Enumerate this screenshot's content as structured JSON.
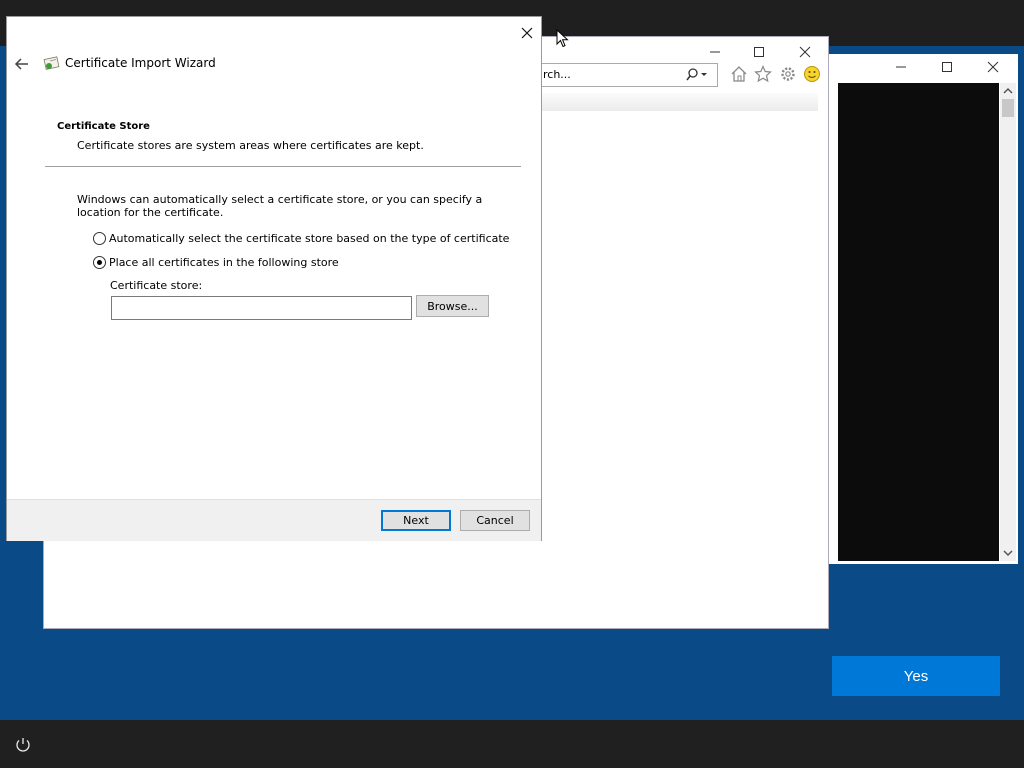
{
  "wizard": {
    "title": "Certificate Import Wizard",
    "section_heading": "Certificate Store",
    "section_subtitle": "Certificate stores are system areas where certificates are kept.",
    "description": "Windows can automatically select a certificate store, or you can specify a location for the certificate.",
    "radio_auto_label": "Automatically select the certificate store based on the type of certificate",
    "radio_auto_selected": false,
    "radio_manual_label": "Place all certificates in the following store",
    "radio_manual_selected": true,
    "store_label": "Certificate store:",
    "store_value": "",
    "browse_label": "Browse...",
    "next_label": "Next",
    "cancel_label": "Cancel"
  },
  "browser": {
    "search_text": "rch..."
  },
  "prompt": {
    "yes_label": "Yes"
  },
  "colors": {
    "desktop": "#0a4a87",
    "accent": "#0078d7",
    "taskbar": "#202020"
  },
  "icons": [
    "power-icon",
    "back-arrow-icon",
    "certificate-icon",
    "close-icon",
    "search-icon",
    "home-icon",
    "favorites-star-icon",
    "gear-icon",
    "smiley-icon",
    "minimize-icon",
    "maximize-icon",
    "mouse-cursor-icon"
  ]
}
